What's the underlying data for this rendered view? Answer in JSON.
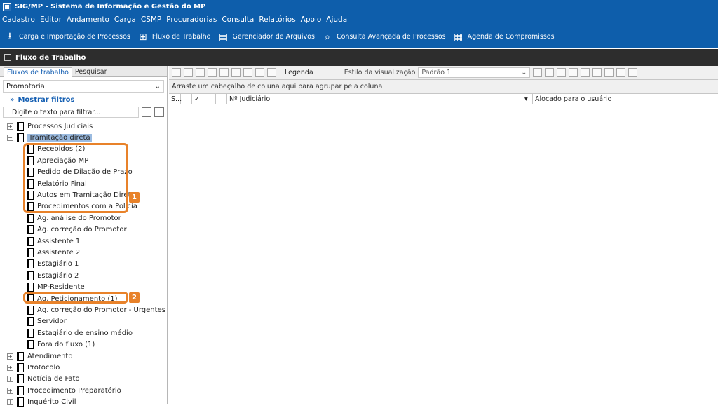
{
  "window": {
    "title": "SIG/MP - Sistema de Informação e Gestão do MP"
  },
  "menu": [
    "Cadastro",
    "Editor",
    "Andamento",
    "Carga",
    "CSMP",
    "Procuradorias",
    "Consulta",
    "Relatórios",
    "Apoio",
    "Ajuda"
  ],
  "toolbar": [
    {
      "label": "Carga e Importação de Processos",
      "icon": "download-icon"
    },
    {
      "label": "Fluxo de Trabalho",
      "icon": "flow-icon"
    },
    {
      "label": "Gerenciador de Arquivos",
      "icon": "folder-icon"
    },
    {
      "label": "Consulta Avançada de Processos",
      "icon": "search-icon"
    },
    {
      "label": "Agenda de Compromissos",
      "icon": "calendar-icon"
    }
  ],
  "panel_title": "Fluxo de Trabalho",
  "left": {
    "tabs": [
      "Fluxos de trabalho",
      "Pesquisar"
    ],
    "combo_value": "Promotoria",
    "show_filters": "Mostrar filtros",
    "filter_placeholder": "Digite o texto para filtrar...",
    "tree": [
      {
        "label": "Processos Judiciais",
        "level": 0,
        "expander": "+"
      },
      {
        "label": "Tramitação direta",
        "level": 0,
        "expander": "−",
        "selected": true
      },
      {
        "label": "Recebidos (2)",
        "level": 1
      },
      {
        "label": "Apreciação MP",
        "level": 1
      },
      {
        "label": "Pedido de Dilação de Prazo",
        "level": 1
      },
      {
        "label": "Relatório Final",
        "level": 1
      },
      {
        "label": "Autos em Tramitação Direta",
        "level": 1
      },
      {
        "label": "Procedimentos com a Polícia",
        "level": 1
      },
      {
        "label": "Ag. análise do Promotor",
        "level": 1
      },
      {
        "label": "Ag. correção do Promotor",
        "level": 1
      },
      {
        "label": "Assistente 1",
        "level": 1
      },
      {
        "label": "Assistente 2",
        "level": 1
      },
      {
        "label": "Estagiário 1",
        "level": 1
      },
      {
        "label": "Estagiário 2",
        "level": 1
      },
      {
        "label": "MP-Residente",
        "level": 1
      },
      {
        "label": "Ag. Peticionamento (1)",
        "level": 1
      },
      {
        "label": "Ag. correção do Promotor - Urgentes",
        "level": 1
      },
      {
        "label": "Servidor",
        "level": 1
      },
      {
        "label": "Estagiário de ensino médio",
        "level": 1
      },
      {
        "label": "Fora do fluxo (1)",
        "level": 1
      },
      {
        "label": "Atendimento",
        "level": 0,
        "expander": "+"
      },
      {
        "label": "Protocolo",
        "level": 0,
        "expander": "+"
      },
      {
        "label": "Notícia de Fato",
        "level": 0,
        "expander": "+"
      },
      {
        "label": "Procedimento Preparatório",
        "level": 0,
        "expander": "+"
      },
      {
        "label": "Inquérito Civil",
        "level": 0,
        "expander": "+"
      }
    ],
    "callouts": [
      "1",
      "2"
    ]
  },
  "right": {
    "legend_label": "Legenda",
    "style_label": "Estilo da visualização",
    "style_value": "Padrão 1",
    "group_hint": "Arraste um cabeçalho de coluna aqui para agrupar pela coluna",
    "columns": [
      "S...",
      "Nº Judiciário",
      "Alocado para o usuário"
    ]
  },
  "colors": {
    "accent": "#0e5eab",
    "callout": "#e8822a",
    "selection": "#9bbbe0"
  }
}
